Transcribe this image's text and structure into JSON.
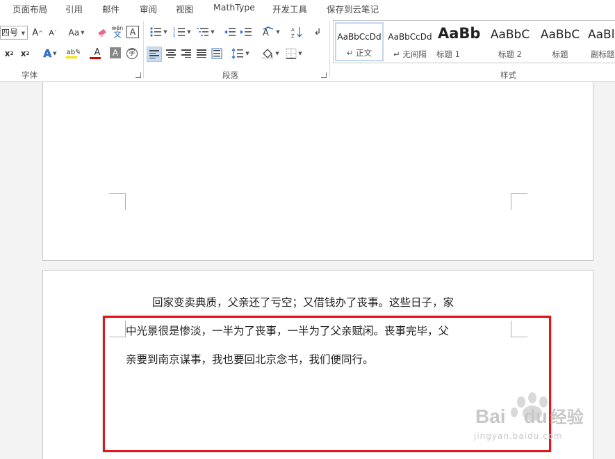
{
  "tabs": [
    "页面布局",
    "引用",
    "邮件",
    "审阅",
    "视图",
    "MathType",
    "开发工具",
    "保存到云笔记"
  ],
  "font_group": {
    "font_size": "四号",
    "grow_label": "A",
    "shrink_label": "A",
    "change_case_label": "Aa",
    "pinyin_label": "wén",
    "subscript_label": "x",
    "superscript_label": "x",
    "group_label": "字体",
    "highlight_color": "#f2e600",
    "font_color": "#e00000"
  },
  "paragraph_group": {
    "group_label": "段落"
  },
  "styles_group": {
    "group_label": "样式",
    "items": [
      {
        "preview": "AaBbCcDd",
        "name": "正文",
        "mark": "↵"
      },
      {
        "preview": "AaBbCcDd",
        "name": "无间隔",
        "mark": "↵"
      },
      {
        "preview": "AaBb",
        "name": "标题 1",
        "mark": ""
      },
      {
        "preview": "AaBbC",
        "name": "标题 2",
        "mark": ""
      },
      {
        "preview": "AaBbC",
        "name": "标题",
        "mark": ""
      },
      {
        "preview": "AaBl",
        "name": "副标题",
        "mark": ""
      }
    ]
  },
  "document": {
    "lines": [
      "回家变卖典质，父亲还了亏空；又借钱办了丧事。这些日子，家",
      "中光景很是惨淡，一半为了丧事，一半为了父亲赋闲。丧事完毕，父",
      "亲要到南京谋事，我也要回北京念书，我们便同行。"
    ],
    "highlight_color": "#e8141a"
  },
  "watermark": {
    "brand": "Bai",
    "brand2": "du",
    "brand3": "经验",
    "url": "jingyan.baidu.com"
  }
}
